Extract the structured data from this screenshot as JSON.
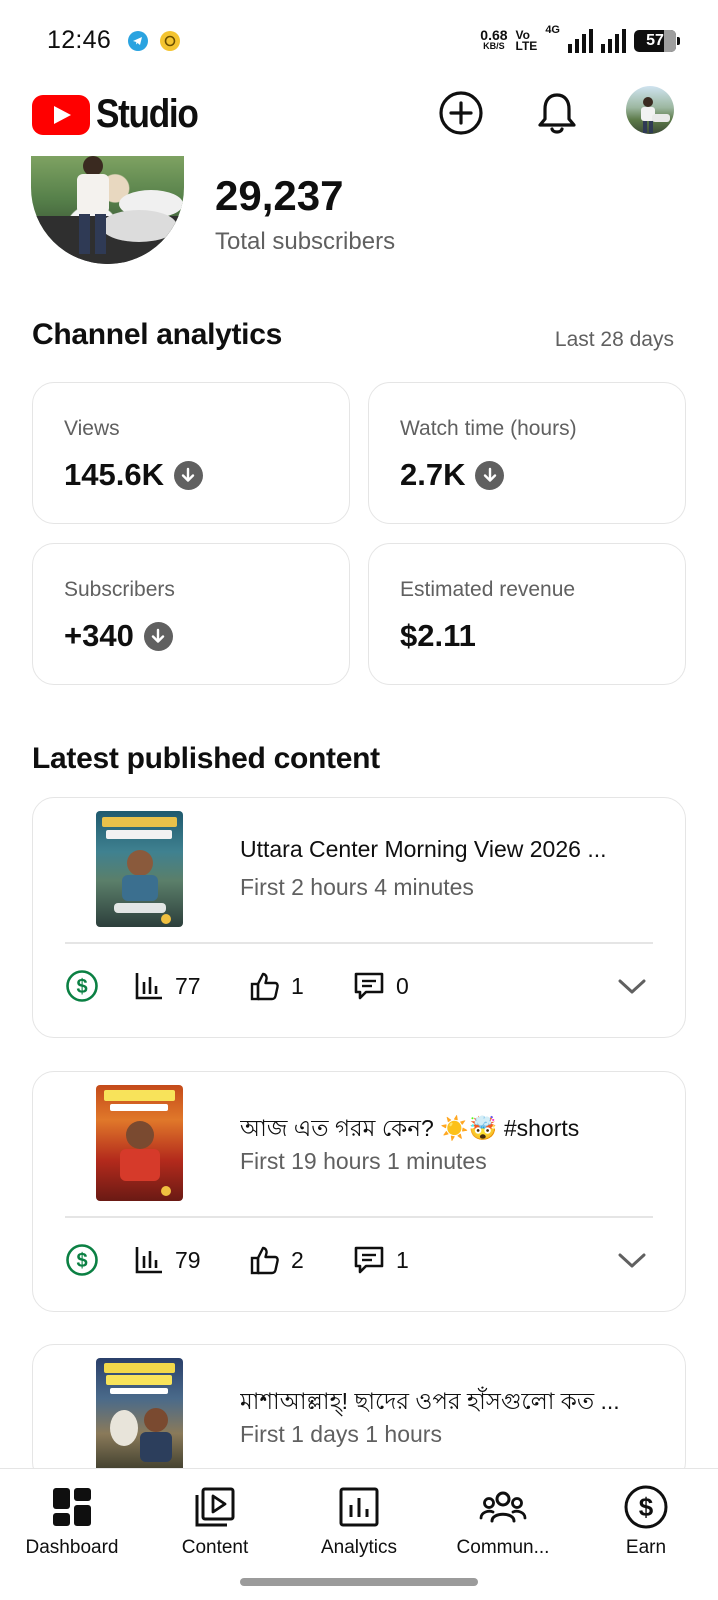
{
  "status_bar": {
    "time": "12:46",
    "net_speed": "0.68",
    "net_unit": "KB/S",
    "volte_top": "Vo",
    "volte_bottom": "LTE",
    "network": "4G",
    "battery": "57",
    "notification_icons": [
      "telegram-icon",
      "notification-dot-icon"
    ],
    "colors": {
      "telegram": "#2aa3e0",
      "notification": "#f4c430"
    }
  },
  "header": {
    "logo_text": "Studio",
    "brand_color": "#ff0000",
    "icons": [
      "create-plus-icon",
      "bell-icon",
      "account-avatar"
    ]
  },
  "channel": {
    "subscriber_count": "29,237",
    "subscriber_label": "Total subscribers"
  },
  "analytics": {
    "title": "Channel analytics",
    "period": "Last 28 days",
    "cards": [
      {
        "label": "Views",
        "value": "145.6K",
        "trend": "down"
      },
      {
        "label": "Watch time (hours)",
        "value": "2.7K",
        "trend": "down"
      },
      {
        "label": "Subscribers",
        "value": "+340",
        "trend": "down"
      },
      {
        "label": "Estimated revenue",
        "value": "$2.11",
        "trend": "none"
      }
    ]
  },
  "latest": {
    "title": "Latest published content",
    "videos": [
      {
        "title": "Uttara Center Morning View 2026 ...",
        "age": "First 2 hours 4 minutes",
        "views": "77",
        "likes": "1",
        "comments": "0"
      },
      {
        "title": "আজ এত গরম কেন? ☀️🤯 #shorts",
        "age": "First 19 hours 1 minutes",
        "views": "79",
        "likes": "2",
        "comments": "1"
      },
      {
        "title": "মাশাআল্লাহ্! ছাদের ওপর হাঁসগুলো কত ...",
        "age": "First 1 days 1 hours"
      }
    ]
  },
  "bottom_nav": {
    "items": [
      {
        "label": "Dashboard",
        "icon": "dashboard-icon"
      },
      {
        "label": "Content",
        "icon": "content-icon"
      },
      {
        "label": "Analytics",
        "icon": "analytics-icon"
      },
      {
        "label": "Commun...",
        "icon": "community-icon"
      },
      {
        "label": "Earn",
        "icon": "earn-icon"
      }
    ]
  },
  "colors": {
    "monetization_green": "#0b8043",
    "secondary_text": "#606060",
    "border": "#e5e5e5"
  }
}
